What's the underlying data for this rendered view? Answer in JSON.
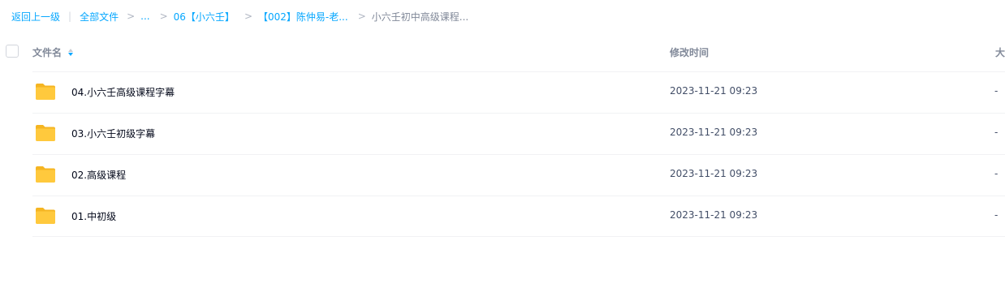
{
  "breadcrumb": {
    "back": "返回上一级",
    "divider": "|",
    "all_files": "全部文件",
    "sep": ">",
    "ellipsis": "...",
    "level1": "06【小六壬】",
    "level2": "【002】陈仲易-老...",
    "current": "小六壬初中高级课程..."
  },
  "table": {
    "col_name": "文件名",
    "col_time": "修改时间",
    "col_size": "大",
    "rows": [
      {
        "name": "04.小六壬高级课程字幕",
        "time": "2023-11-21 09:23",
        "size": "-",
        "icon": "folder-icon"
      },
      {
        "name": "03.小六壬初级字幕",
        "time": "2023-11-21 09:23",
        "size": "-",
        "icon": "folder-icon"
      },
      {
        "name": "02.高级课程",
        "time": "2023-11-21 09:23",
        "size": "-",
        "icon": "folder-icon"
      },
      {
        "name": "01.中初级",
        "time": "2023-11-21 09:23",
        "size": "-",
        "icon": "folder-icon"
      }
    ]
  },
  "colors": {
    "link": "#06a7ff",
    "folder": "#ffc93d",
    "folder_back": "#f5b522"
  }
}
